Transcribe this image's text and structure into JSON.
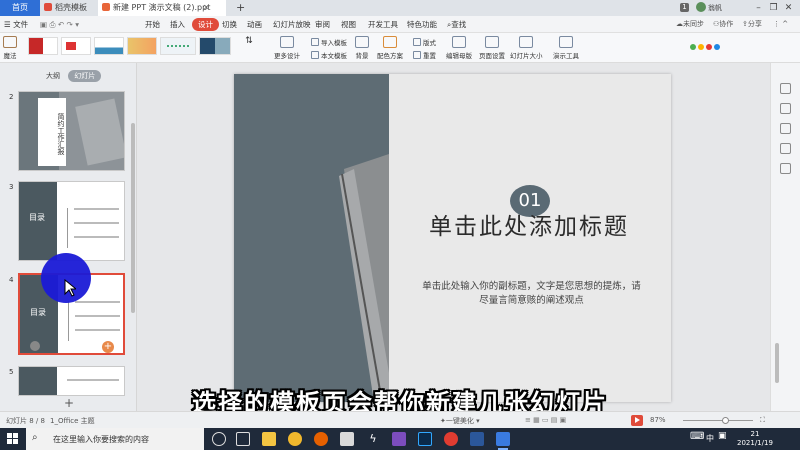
{
  "tabs": {
    "home": "首页",
    "daoke": "稻壳模板",
    "document": "新建 PPT 演示文稿 (2).ppt"
  },
  "user": {
    "badge": "1",
    "name": "翁帆"
  },
  "menu": {
    "file": "文件",
    "items": [
      "开始",
      "插入",
      "设计",
      "切换",
      "动画",
      "幻灯片放映",
      "审阅",
      "视图",
      "开发工具",
      "特色功能"
    ],
    "active_index": 2,
    "search": "查找",
    "cloud": "未同步",
    "collab": "协作",
    "share": "分享"
  },
  "ribbon": {
    "magic": "魔法",
    "more_design": "更多设计",
    "import_template": "导入模板",
    "this_text_template": "本文模板",
    "background": "背景",
    "color_scheme": "配色方案",
    "layout": "版式",
    "reset": "重置",
    "edit_master": "编辑母版",
    "page_setup": "页面设置",
    "slide_size": "幻灯片大小",
    "presentation_tools": "演示工具"
  },
  "left_panel": {
    "outline_tab": "大纲",
    "slides_tab": "幻灯片",
    "thumbnails": [
      {
        "number": "2",
        "title": "简约工作汇报"
      },
      {
        "number": "3",
        "title": "目录"
      },
      {
        "number": "4",
        "title": "目录"
      },
      {
        "number": "5",
        "title": ""
      }
    ]
  },
  "slide": {
    "number": "01",
    "title": "单击此处添加标题",
    "subtitle": "单击此处输入你的副标题，文字是您思想的提炼，请尽量言简意赅的阐述观点"
  },
  "caption": "选择的模板页会帮你新建几张幻灯片",
  "status": {
    "slide_info": "幻灯片 8 / 8",
    "theme": "1_Office 主题",
    "beautify": "一键美化",
    "zoom": "87%"
  },
  "taskbar": {
    "search_placeholder": "在这里输入你要搜索的内容",
    "ime": "中",
    "time": "21",
    "date": "2021/1/19"
  },
  "colors": {
    "accent": "#e04b3a",
    "tab_blue": "#2f6fd6",
    "slide_dark": "#5e6c74",
    "taskbar": "#1f2a3a"
  }
}
